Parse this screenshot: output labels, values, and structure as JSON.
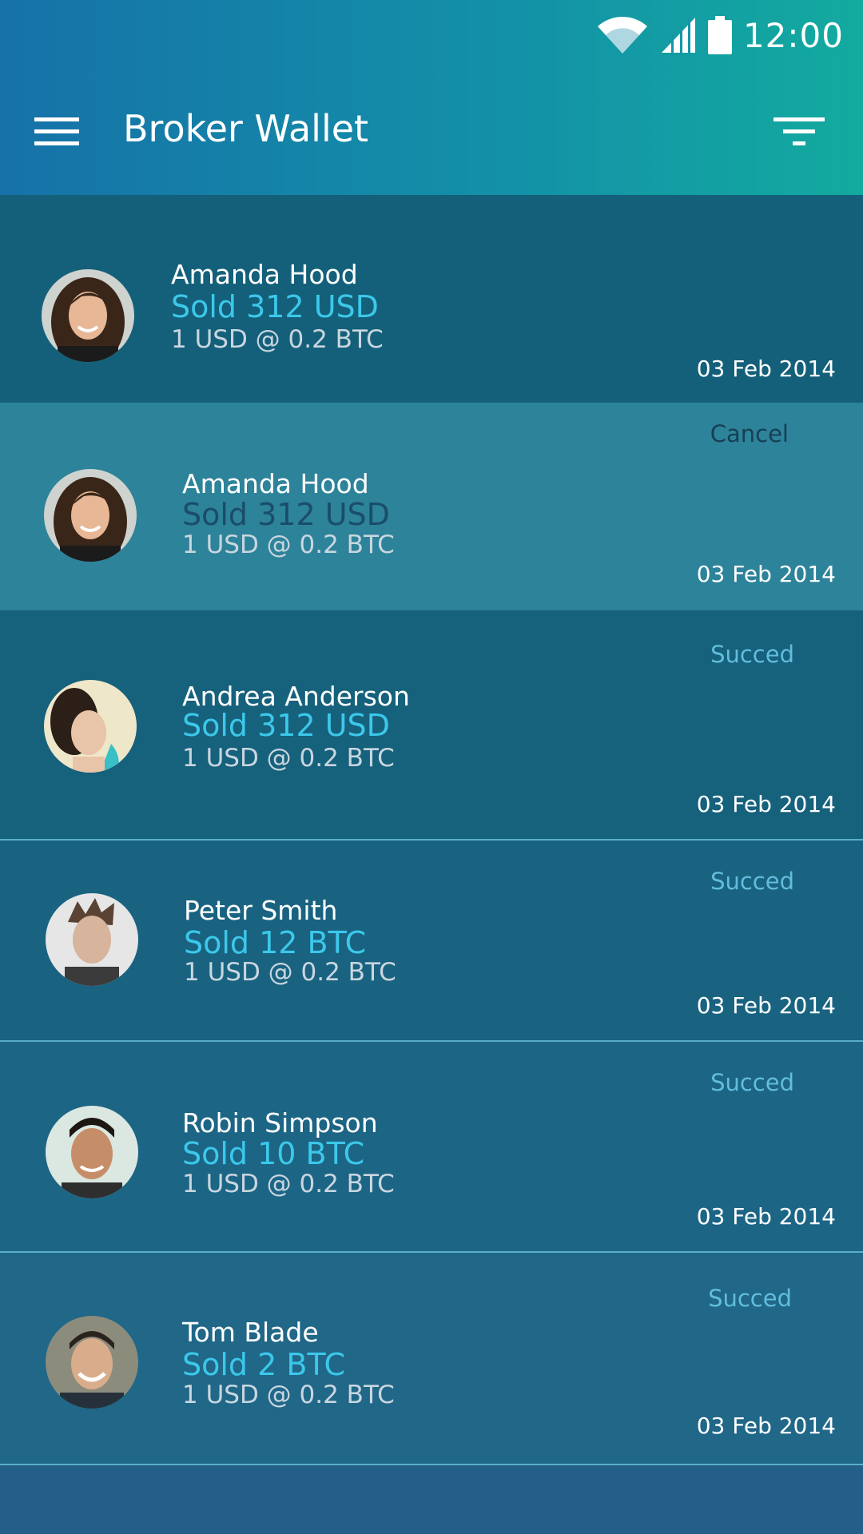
{
  "status_bar": {
    "time": "12:00",
    "icons": [
      "wifi-icon",
      "cell-signal-icon",
      "battery-icon"
    ]
  },
  "app_bar": {
    "title": "Broker Wallet",
    "menu_icon": "hamburger-menu-icon",
    "filter_icon": "filter-icon"
  },
  "colors": {
    "accent": "#3cc8ea",
    "status_text": "#62bddc",
    "appbar_start": "#1672a8",
    "appbar_end": "#13aa9f"
  },
  "transactions": [
    {
      "name": "Amanda Hood",
      "action": "Sold 312 USD",
      "rate": "1 USD @ 0.2 BTC",
      "date": "03 Feb 2014",
      "status": ""
    },
    {
      "name": "Amanda Hood",
      "action": "Sold 312 USD",
      "rate": "1 USD @ 0.2 BTC",
      "date": "03 Feb 2014",
      "status": "Cancel"
    },
    {
      "name": "Andrea Anderson",
      "action": "Sold 312 USD",
      "rate": "1 USD @ 0.2 BTC",
      "date": "03 Feb 2014",
      "status": "Succed"
    },
    {
      "name": "Peter Smith",
      "action": "Sold 12 BTC",
      "rate": "1 USD @ 0.2 BTC",
      "date": "03 Feb 2014",
      "status": "Succed"
    },
    {
      "name": "Robin Simpson",
      "action": "Sold 10 BTC",
      "rate": "1 USD @ 0.2 BTC",
      "date": "03 Feb 2014",
      "status": "Succed"
    },
    {
      "name": "Tom Blade",
      "action": "Sold 2 BTC",
      "rate": "1 USD @ 0.2 BTC",
      "date": "03 Feb 2014",
      "status": "Succed"
    }
  ]
}
